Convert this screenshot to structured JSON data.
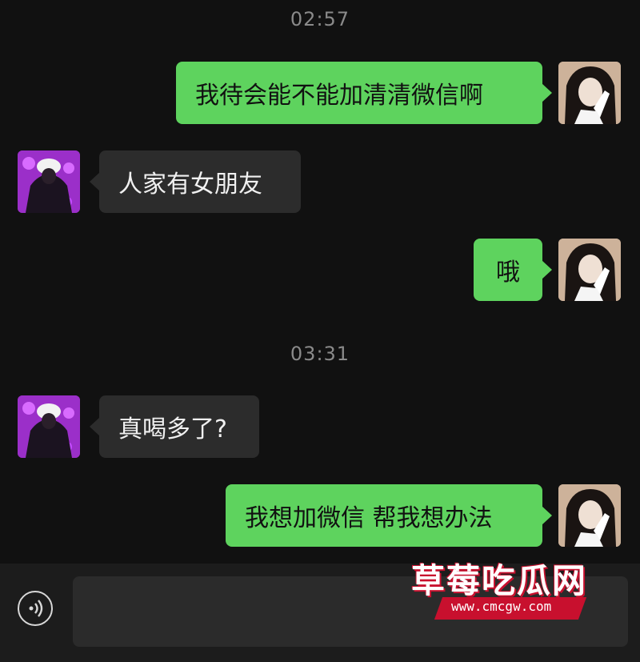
{
  "timestamps": [
    "02:57",
    "03:31"
  ],
  "messages": [
    {
      "sender": "me",
      "text": "我待会能不能加清清微信啊"
    },
    {
      "sender": "other",
      "text": "人家有女朋友"
    },
    {
      "sender": "me",
      "text": "哦"
    },
    {
      "sender": "other",
      "text": "真喝多了?"
    },
    {
      "sender": "me",
      "text": "我想加微信 帮我想办法"
    }
  ],
  "input_bar": {
    "voice_icon": "voice-icon",
    "input_value": ""
  },
  "watermark": {
    "title": "草莓吃瓜网",
    "url": "www.cmcgw.com"
  },
  "colors": {
    "background": "#111111",
    "my_bubble": "#5ed35e",
    "other_bubble": "#2c2c2c",
    "watermark_accent": "#c8102e"
  }
}
